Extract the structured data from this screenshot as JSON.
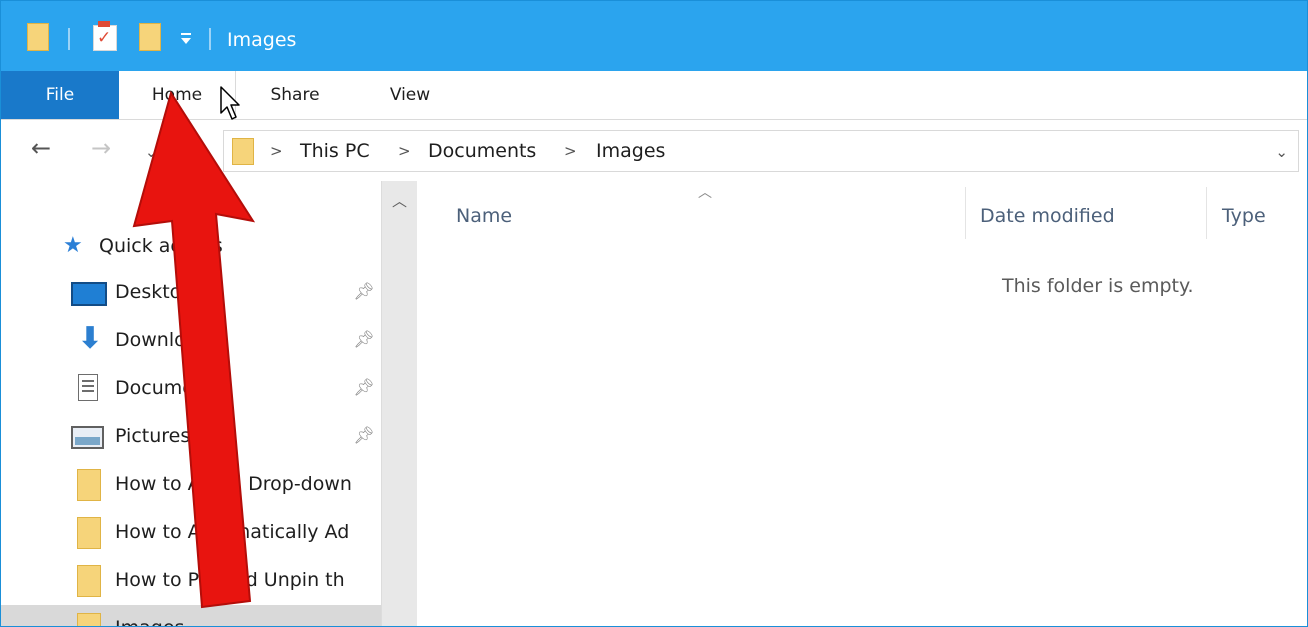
{
  "window": {
    "title": "Images"
  },
  "ribbon": {
    "tabs": [
      {
        "label": "File"
      },
      {
        "label": "Home"
      },
      {
        "label": "Share"
      },
      {
        "label": "View"
      }
    ]
  },
  "address": {
    "separator": ">",
    "crumbs": [
      "This PC",
      "Documents",
      "Images"
    ]
  },
  "nav_pane": {
    "quick_access_label": "Quick access",
    "items": [
      {
        "label": "Desktop",
        "icon": "desktop-icon",
        "pinned": true
      },
      {
        "label": "Downloads",
        "icon": "download-icon",
        "pinned": true
      },
      {
        "label": "Documents",
        "icon": "documents-icon",
        "pinned": true
      },
      {
        "label": "Pictures",
        "icon": "pictures-icon",
        "pinned": true
      },
      {
        "label": "How to Add a Drop-down",
        "icon": "folder-icon",
        "pinned": false
      },
      {
        "label": "How to Automatically Ad",
        "icon": "folder-icon",
        "pinned": false
      },
      {
        "label": "How to Pin and Unpin th",
        "icon": "folder-icon",
        "pinned": false
      },
      {
        "label": "Images",
        "icon": "folder-icon",
        "pinned": false,
        "selected": true
      }
    ]
  },
  "content": {
    "columns": [
      "Name",
      "Date modified",
      "Type"
    ],
    "sorted_column": "Name",
    "empty_message": "This folder is empty."
  },
  "colors": {
    "titlebar": "#2ba4ee",
    "file_tab": "#1979ca",
    "folder": "#f6d47a",
    "annotation_arrow": "#e8140f"
  }
}
